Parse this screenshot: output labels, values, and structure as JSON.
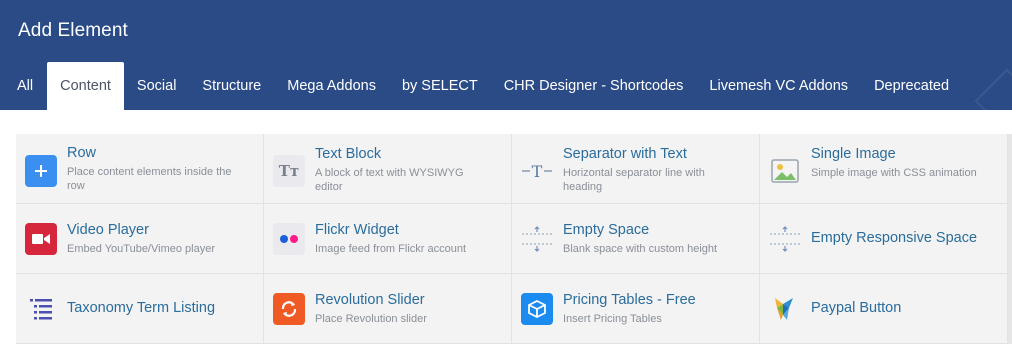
{
  "header": {
    "title": "Add Element",
    "tabs": [
      "All",
      "Content",
      "Social",
      "Structure",
      "Mega Addons",
      "by SELECT",
      "CHR Designer - Shortcodes",
      "Livemesh VC Addons",
      "Deprecated"
    ],
    "active_tab": "Content"
  },
  "elements": [
    {
      "name": "Row",
      "desc": "Place content elements inside the row",
      "icon": "plus-icon",
      "color": "#3b8ff0"
    },
    {
      "name": "Text Block",
      "desc": "A block of text with WYSIWYG editor",
      "icon": "text-block-icon"
    },
    {
      "name": "Separator with Text",
      "desc": "Horizontal separator line with heading",
      "icon": "separator-icon"
    },
    {
      "name": "Single Image",
      "desc": "Simple image with CSS animation",
      "icon": "image-icon"
    },
    {
      "name": "Video Player",
      "desc": "Embed YouTube/Vimeo player",
      "icon": "video-icon",
      "color": "#d5263c"
    },
    {
      "name": "Flickr Widget",
      "desc": "Image feed from Flickr account",
      "icon": "flickr-icon"
    },
    {
      "name": "Empty Space",
      "desc": "Blank space with custom height",
      "icon": "empty-space-icon"
    },
    {
      "name": "Empty Responsive Space",
      "desc": "",
      "icon": "empty-space-icon"
    },
    {
      "name": "Taxonomy Term Listing",
      "desc": "",
      "icon": "list-icon",
      "color": "#4a4fb0"
    },
    {
      "name": "Revolution Slider",
      "desc": "Place Revolution slider",
      "icon": "revolution-slider-icon",
      "color": "#f05a24"
    },
    {
      "name": "Pricing Tables - Free",
      "desc": "Insert Pricing Tables",
      "icon": "pricing-tables-icon",
      "color": "#1c8bf0"
    },
    {
      "name": "Paypal Button",
      "desc": "",
      "icon": "paypal-logo-icon"
    }
  ]
}
